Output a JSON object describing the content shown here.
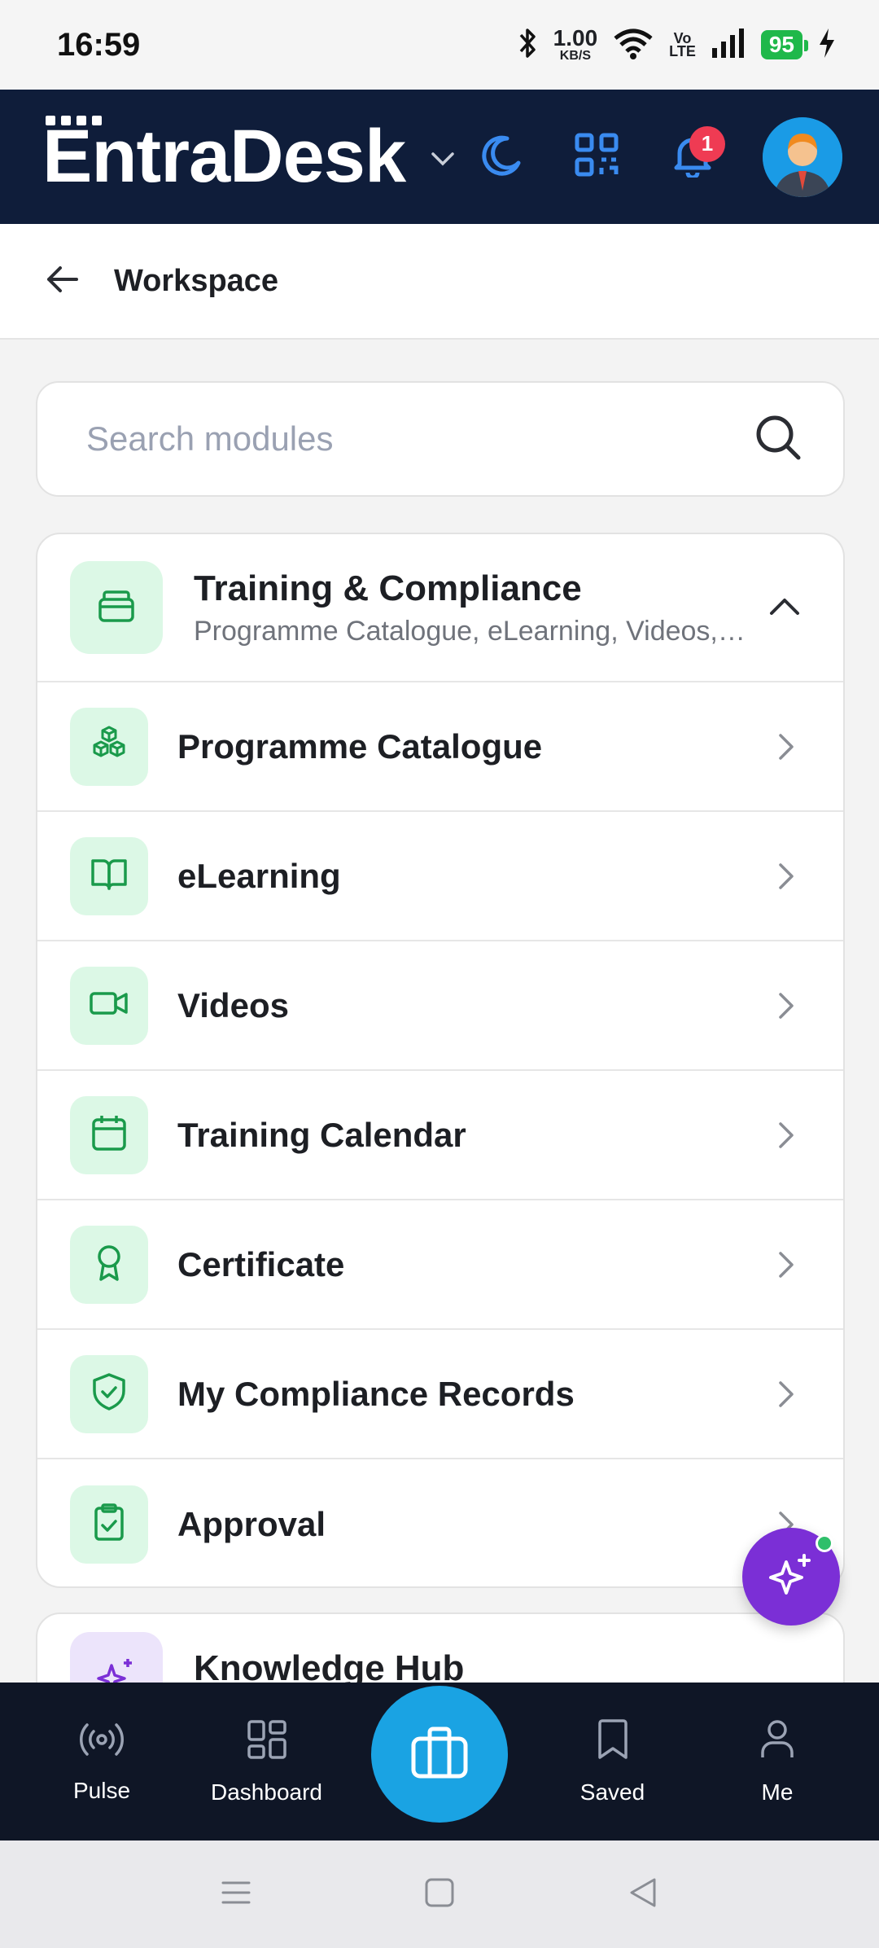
{
  "status_bar": {
    "time": "16:59",
    "net_speed_value": "1.00",
    "net_speed_unit": "KB/S",
    "volte_top": "Vo",
    "volte_bottom": "LTE",
    "battery": "95"
  },
  "header": {
    "brand": "EntraDesk",
    "notification_count": "1"
  },
  "subheader": {
    "title": "Workspace"
  },
  "search": {
    "placeholder": "Search modules"
  },
  "section": {
    "title": "Training & Compliance",
    "subtitle": "Programme Catalogue, eLearning, Videos, Training Calendar, Certificate",
    "items": [
      {
        "label": "Programme Catalogue",
        "icon": "cubes-icon"
      },
      {
        "label": "eLearning",
        "icon": "book-icon"
      },
      {
        "label": "Videos",
        "icon": "video-icon"
      },
      {
        "label": "Training Calendar",
        "icon": "calendar-icon"
      },
      {
        "label": "Certificate",
        "icon": "award-icon"
      },
      {
        "label": "My Compliance Records",
        "icon": "shield-check-icon"
      },
      {
        "label": "Approval",
        "icon": "clipboard-check-icon"
      }
    ]
  },
  "section2": {
    "title": "Knowledge Hub"
  },
  "bottom_nav": {
    "items": [
      {
        "label": "Pulse",
        "icon": "broadcast-icon"
      },
      {
        "label": "Dashboard",
        "icon": "grid-icon"
      },
      {
        "label": "Saved",
        "icon": "bookmark-icon"
      },
      {
        "label": "Me",
        "icon": "user-icon"
      }
    ],
    "center_icon": "briefcase-icon"
  },
  "colors": {
    "header_bg": "#0f1d3a",
    "accent_blue": "#1aa3e3",
    "icon_green": "#1a9a4b",
    "icon_green_bg": "#dcf8e6",
    "ai_purple": "#7b2fd6",
    "badge_red": "#ef3b53"
  }
}
